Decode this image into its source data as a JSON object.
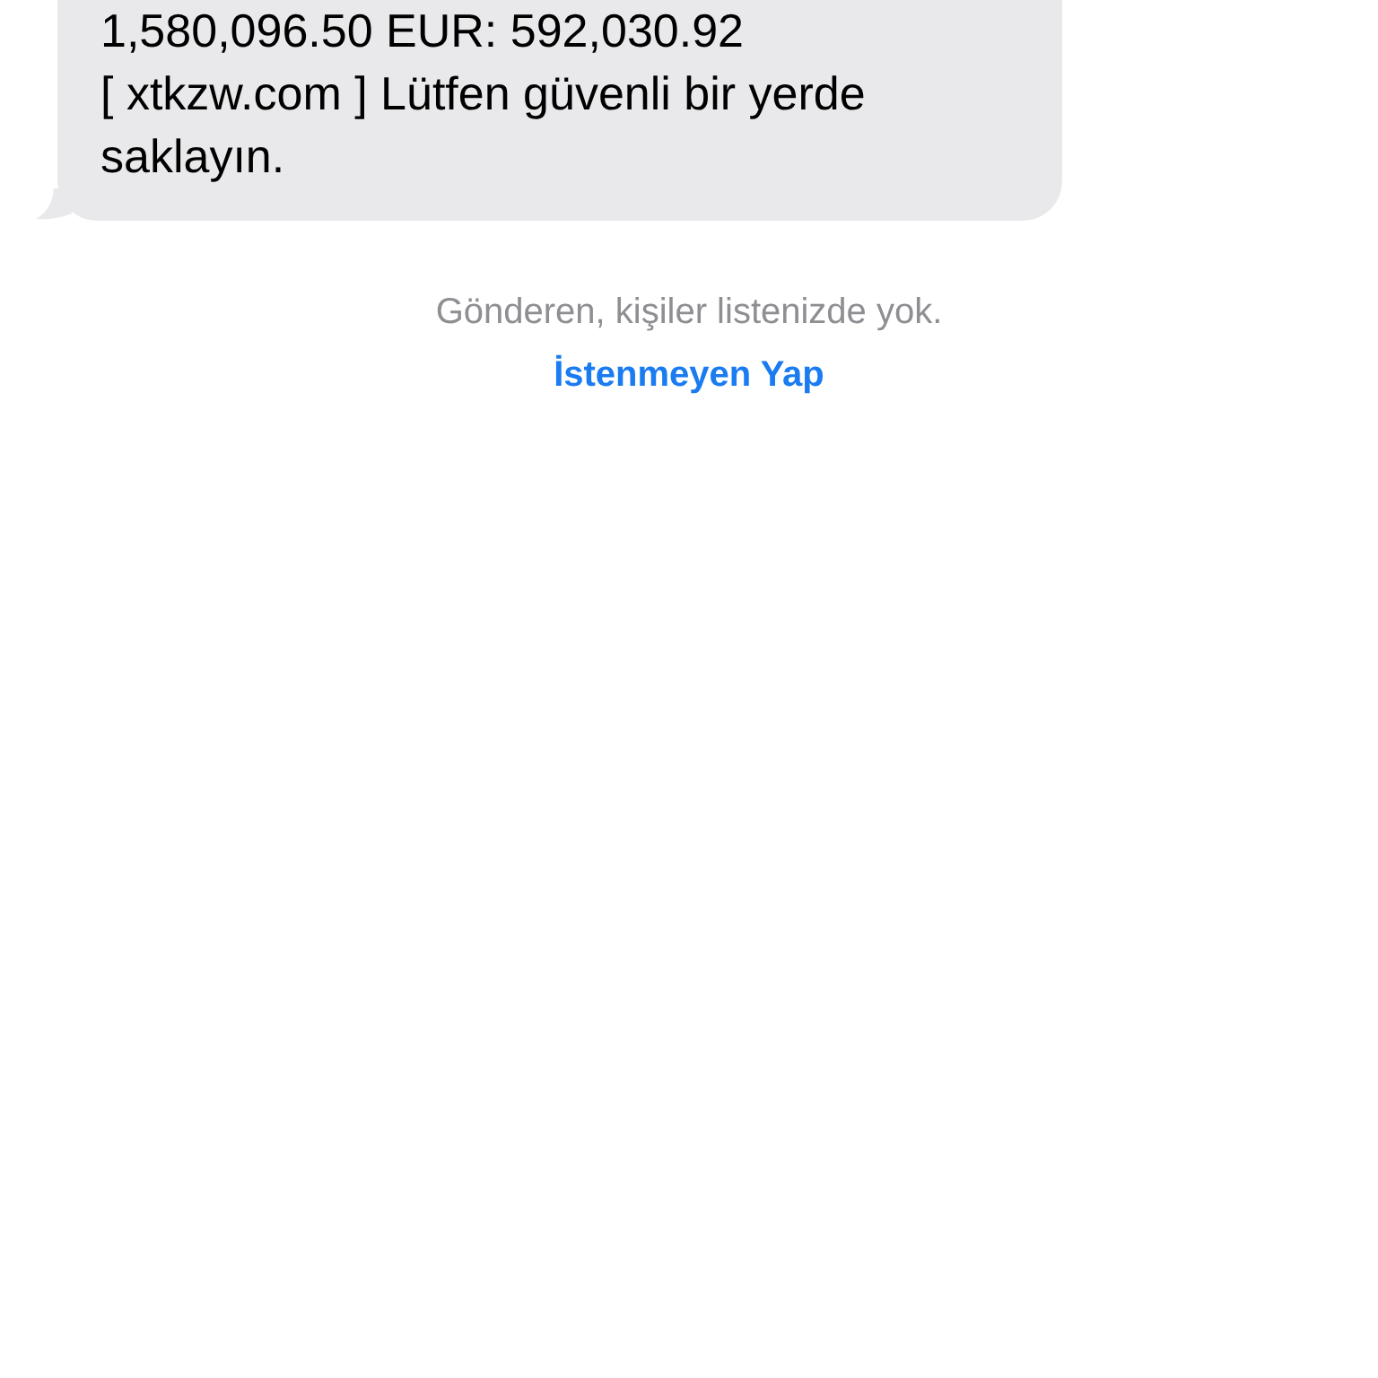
{
  "message": {
    "text": "1,580,096.50 EUR: 592,030.92\n[ xtkzw.com ] Lütfen güvenli bir yerde\nsaklayın."
  },
  "sender_notice": "Gönderen, kişiler listenizde yok.",
  "report_link": "İstenmeyen Yap"
}
